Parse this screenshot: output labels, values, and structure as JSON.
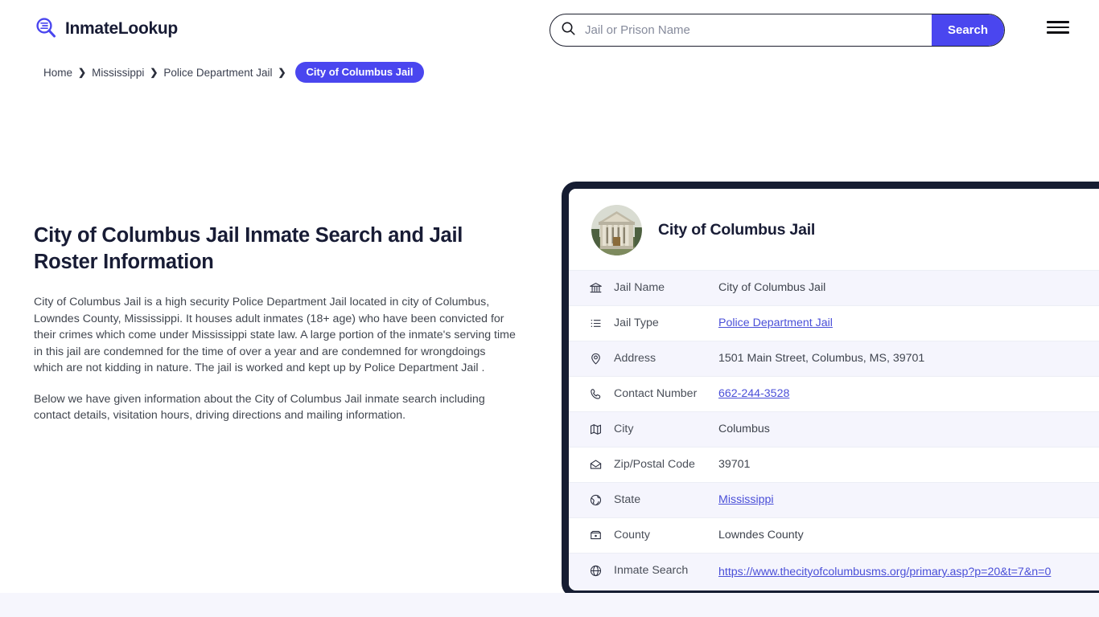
{
  "brand": {
    "name": "InmateLookup",
    "logo_icon": "magnifier-list-icon",
    "accent_color": "#4a46ef",
    "dark_color": "#161d32"
  },
  "search": {
    "placeholder": "Jail or Prison Name",
    "value": "",
    "button_label": "Search",
    "icon": "search-icon"
  },
  "menu": {
    "icon": "hamburger-menu-icon"
  },
  "breadcrumb": {
    "items": [
      {
        "label": "Home"
      },
      {
        "label": "Mississippi"
      },
      {
        "label": "Police Department Jail"
      }
    ],
    "separator": "❯",
    "current": "City of Columbus Jail"
  },
  "article": {
    "title": "City of Columbus Jail Inmate Search and Jail Roster Information",
    "paragraphs": [
      "City of Columbus Jail is a high security Police Department Jail located in city of Columbus, Lowndes County, Mississippi. It houses adult inmates (18+ age) who have been convicted for their crimes which come under Mississippi state law. A large portion of the inmate's serving time in this jail are condemned for the time of over a year and are condemned for wrongdoings which are not kidding in nature. The jail is worked and kept up by Police Department Jail .",
      "Below we have given information about the City of Columbus Jail inmate search including contact details, visitation hours, driving directions and mailing information."
    ]
  },
  "card": {
    "avatar_icon": "courthouse-building-photo",
    "title": "City of Columbus Jail",
    "rows": [
      {
        "icon": "bank-icon",
        "label": "Jail Name",
        "value": "City of Columbus Jail",
        "link": false
      },
      {
        "icon": "list-icon",
        "label": "Jail Type",
        "value": "Police Department Jail",
        "link": true
      },
      {
        "icon": "map-pin-icon",
        "label": "Address",
        "value": "1501 Main Street, Columbus, MS, 39701",
        "link": false
      },
      {
        "icon": "phone-icon",
        "label": "Contact Number",
        "value": "662-244-3528",
        "link": true
      },
      {
        "icon": "map-icon",
        "label": "City",
        "value": "Columbus",
        "link": false
      },
      {
        "icon": "envelope-icon",
        "label": "Zip/Postal Code",
        "value": "39701",
        "link": false
      },
      {
        "icon": "globe-shield-icon",
        "label": "State",
        "value": "Mississippi",
        "link": true
      },
      {
        "icon": "map-flag-icon",
        "label": "County",
        "value": "Lowndes County",
        "link": false
      },
      {
        "icon": "globe-icon",
        "label": "Inmate Search",
        "value": "https://www.thecityofcolumbusms.org/primary.asp?p=20&t=7&n=0",
        "link": true
      }
    ]
  }
}
